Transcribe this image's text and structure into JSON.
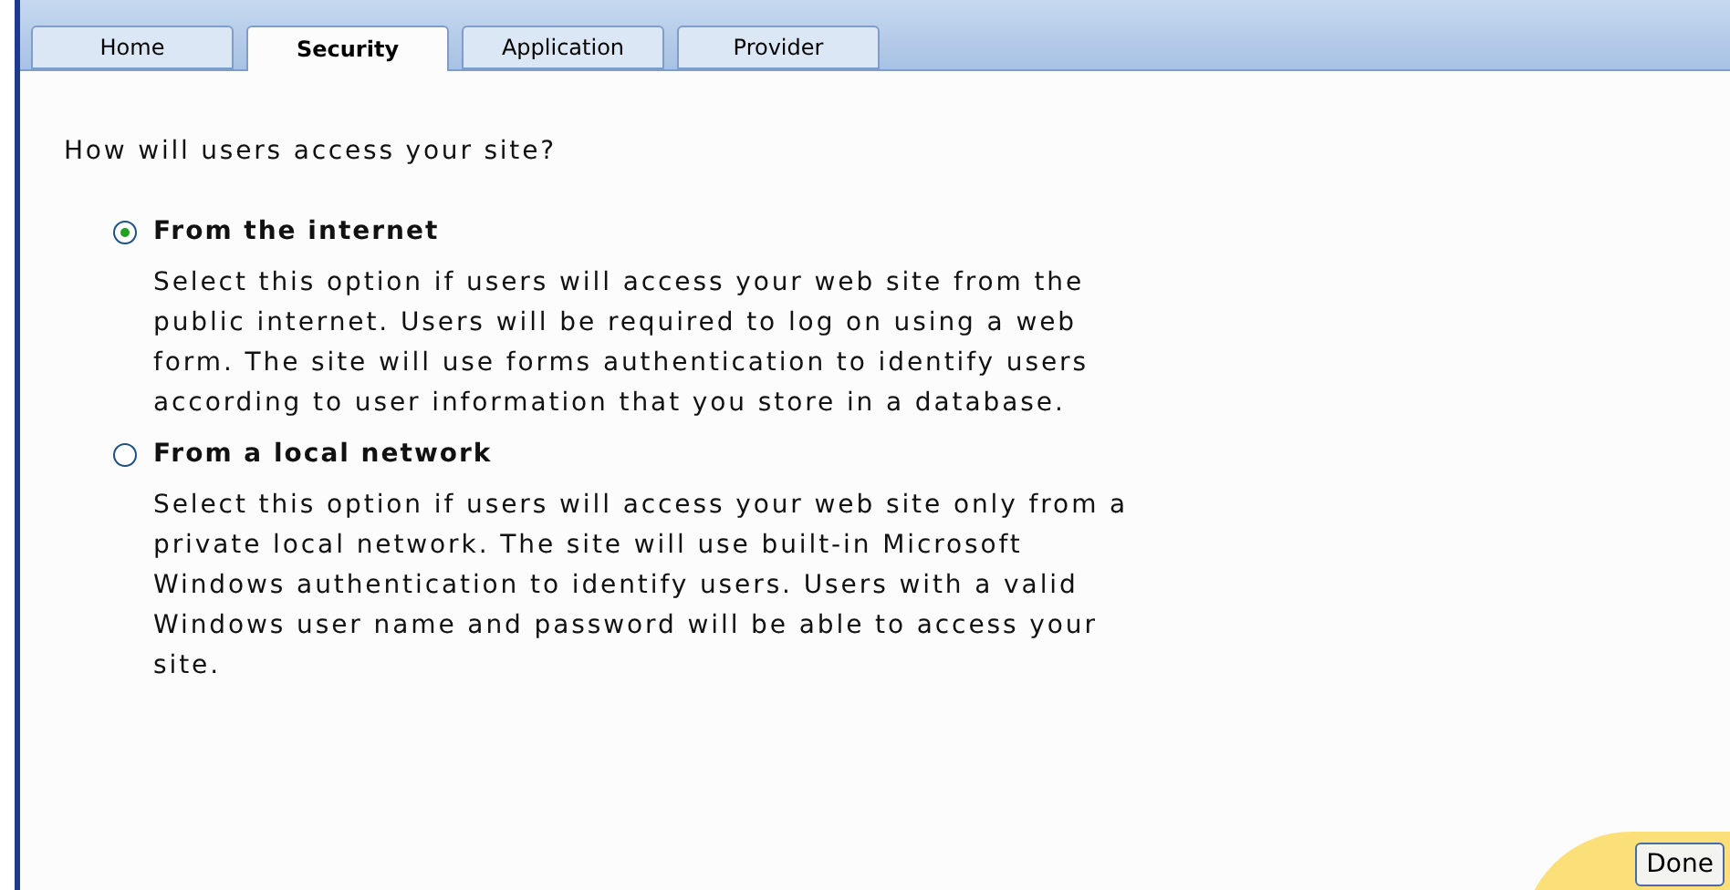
{
  "tabs": [
    {
      "label": "Home",
      "selected": false
    },
    {
      "label": "Security",
      "selected": true
    },
    {
      "label": "Application",
      "selected": false
    },
    {
      "label": "Provider",
      "selected": false
    }
  ],
  "question": "How will users access your site?",
  "options": [
    {
      "label": "From the internet",
      "selected": true,
      "description": "Select this option if users will access your web site from the public internet. Users will be required to log on using a web form. The site will use forms authentication to identify users according to user information that you store in a database."
    },
    {
      "label": "From a local network",
      "selected": false,
      "description": "Select this option if users will access your web site only from a private local network. The site will use built-in Microsoft Windows authentication to identify users. Users with a valid Windows user name and password will be able to access your site."
    }
  ],
  "done_button": "Done"
}
